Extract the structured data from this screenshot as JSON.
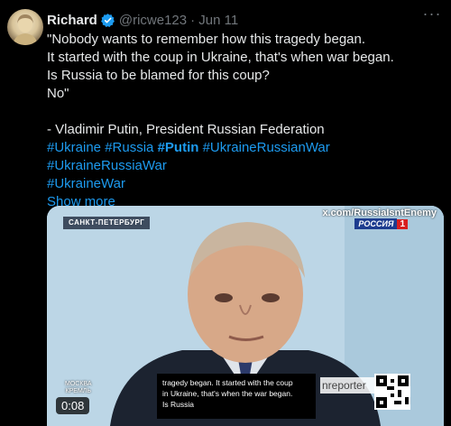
{
  "tweet": {
    "author": {
      "display_name": "Richard",
      "handle": "@ricwe123",
      "date": "· Jun 11",
      "verified": true
    },
    "more_icon": "more-horizontal-icon",
    "lines": [
      "\"Nobody wants to remember how this tragedy began.",
      "It started with the coup in Ukraine, that's when war began.",
      "Is Russia to be blamed for this coup?",
      "No\"",
      "",
      "- Vladimir Putin, President Russian Federation"
    ],
    "hashtags": {
      "line1": [
        "#Ukraine",
        "#Russia",
        "#Putin",
        "#UkraineRussianWar"
      ],
      "line2": [
        "#UkraineRussiaWar"
      ],
      "line3": [
        "#UkraineWar"
      ]
    },
    "show_more": "Show more"
  },
  "video": {
    "location_badge": "САНКТ-ПЕТЕРБУРГ",
    "source_tag": "x.com/RussiaIsntEnemy",
    "channel_name": "РОССИЯ",
    "channel_number": "1",
    "moscow_line1": "МОСКВА",
    "moscow_line2": "КРЕМЛЬ",
    "timer": "0:08",
    "subtitle_lines": [
      "tragedy began. It started with the coup",
      "in Ukraine, that's when the war began.",
      "Is Russia"
    ],
    "watermark": "nreporter"
  },
  "colors": {
    "link": "#1d9bf0",
    "muted": "#71767b",
    "text": "#e7e9ea",
    "background": "#000000"
  }
}
